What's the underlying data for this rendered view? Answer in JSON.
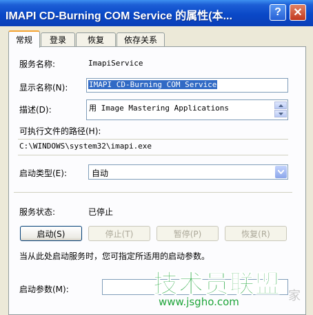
{
  "window": {
    "title": "IMAPI CD-Burning COM Service 的属性(本...",
    "help_glyph": "?",
    "close_glyph": "✕"
  },
  "tabs": [
    {
      "label": "常规",
      "active": true
    },
    {
      "label": "登录",
      "active": false
    },
    {
      "label": "恢复",
      "active": false
    },
    {
      "label": "依存关系",
      "active": false
    }
  ],
  "general": {
    "service_name_label": "服务名称:",
    "service_name_value": "ImapiService",
    "display_name_label": "显示名称(N):",
    "display_name_value": "IMAPI CD-Burning COM Service",
    "description_label": "描述(D):",
    "description_value": "用 Image Mastering Applications",
    "exe_path_label": "可执行文件的路径(H):",
    "exe_path_value": "C:\\WINDOWS\\system32\\imapi.exe",
    "startup_type_label": "启动类型(E):",
    "startup_type_value": "自动",
    "service_status_label": "服务状态:",
    "service_status_value": "已停止",
    "buttons": {
      "start": "启动(S)",
      "stop": "停止(T)",
      "pause": "暂停(P)",
      "resume": "恢复(R)"
    },
    "hint_text": "当从此处启动服务时，您可指定所适用的启动参数。",
    "start_params_label": "启动参数(M):",
    "start_params_value": ""
  },
  "watermark": {
    "main": "技术员联盟",
    "sub": "www.jsgho.com",
    "tail": "家"
  }
}
